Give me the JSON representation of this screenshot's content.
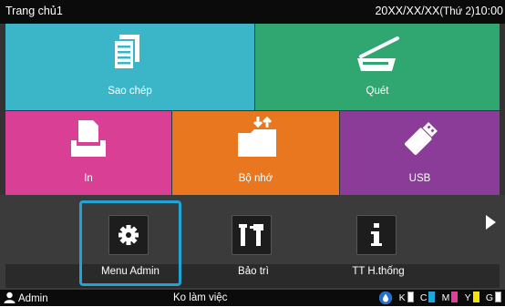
{
  "header": {
    "title": "Trang chủ1",
    "date": "20XX/XX/XX",
    "weekday": "(Thứ 2)",
    "time": "10:00"
  },
  "tiles": [
    {
      "label": "Sao chép",
      "icon": "document-stack-icon",
      "color": "#3ab6c8"
    },
    {
      "label": "Quét",
      "icon": "scanner-icon",
      "color": "#30a771"
    },
    {
      "label": "In",
      "icon": "printer-icon",
      "color": "#d93f95"
    },
    {
      "label": "Bộ nhớ",
      "icon": "folder-transfer-icon",
      "color": "#e8771f"
    },
    {
      "label": "USB",
      "icon": "usb-stick-icon",
      "color": "#8a3c98"
    }
  ],
  "shelf": {
    "apps": [
      {
        "label": "Menu Admin",
        "icon": "gear-icon",
        "selected": true
      },
      {
        "label": "Bảo trì",
        "icon": "tools-icon",
        "selected": false
      },
      {
        "label": "TT H.thống",
        "icon": "info-icon",
        "selected": false
      }
    ],
    "next_icon": "play-arrow-icon",
    "selection_color": "#1ea5d6"
  },
  "status": {
    "user": "Admin",
    "state": "Ko làm việc",
    "inks": [
      {
        "name": "K",
        "color": "#ffffff"
      },
      {
        "name": "C",
        "color": "#21a6d9"
      },
      {
        "name": "M",
        "color": "#e23d98"
      },
      {
        "name": "Y",
        "color": "#f2e600"
      },
      {
        "name": "G",
        "color": "#ffffff"
      }
    ]
  }
}
